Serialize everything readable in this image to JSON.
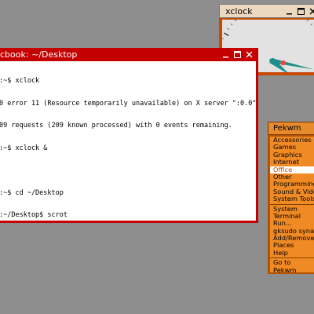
{
  "xclock": {
    "title": "xclock",
    "buttons": [
      "minimize",
      "maximize",
      "close"
    ],
    "time": {
      "hour": 4,
      "minute": 17
    }
  },
  "terminal": {
    "title": "cbook: ~/Desktop",
    "buttons": [
      "minimize",
      "maximize",
      "close"
    ],
    "lines": [
      ":~$ xclock",
      "0 error 11 (Resource temporarily unavailable) on X server \":0.0\"",
      "09 requests (209 known processed) with 0 events remaining.",
      ":~$ xclock &",
      "",
      ":~$ cd ~/Desktop",
      ":~/Desktop$ scrot"
    ]
  },
  "menu": {
    "title": "Pekwm",
    "items_group1": [
      "Accessories",
      "Games",
      "Graphics",
      "Internet",
      "Office",
      "Other",
      "Programming",
      "Sound & Video",
      "System Tools"
    ],
    "selected": "Office",
    "items_group2": [
      "System",
      "Terminal",
      "Run...",
      "gksudo synaptic",
      "Add/Remove",
      "Places",
      "Help"
    ],
    "items_group3": [
      "Go to",
      "Pekwm"
    ]
  },
  "colors": {
    "desktop": "#8e8e8e",
    "terminal_frame": "#c50000",
    "clock_frame": "#c74a00",
    "menu_bg": "#f08a24",
    "menu_selected_text": "#c44a00"
  }
}
